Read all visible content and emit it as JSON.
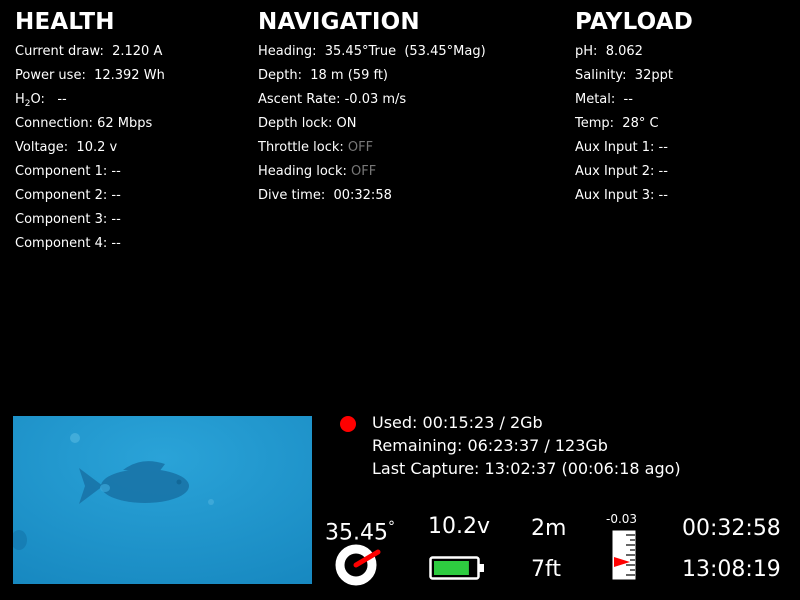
{
  "health": {
    "title": "HEALTH",
    "current_draw_label": "Current draw:",
    "current_draw_value": "2.120 A",
    "power_use_label": "Power use:",
    "power_use_value": "12.392 Wh",
    "h2o_prefix": "H",
    "h2o_sub": "2",
    "h2o_suffix": "O:",
    "h2o_value": "--",
    "connection_label": "Connection:",
    "connection_value": "62 Mbps",
    "voltage_label": "Voltage:",
    "voltage_value": "10.2 v",
    "component1_label": "Component 1:",
    "component1_value": "--",
    "component2_label": "Component 2:",
    "component2_value": "--",
    "component3_label": "Component 3:",
    "component3_value": "--",
    "component4_label": "Component 4:",
    "component4_value": "--"
  },
  "navigation": {
    "title": "NAVIGATION",
    "heading_label": "Heading:",
    "heading_value": "35.45°True  (53.45°Mag)",
    "depth_label": "Depth:",
    "depth_value": "18 m (59 ft)",
    "ascent_label": "Ascent Rate:",
    "ascent_value": "-0.03 m/s",
    "depth_lock_label": "Depth lock:",
    "depth_lock_value": "ON",
    "throttle_lock_label": "Throttle lock:",
    "throttle_lock_value": "OFF",
    "heading_lock_label": "Heading lock:",
    "heading_lock_value": "OFF",
    "dive_time_label": "Dive time:",
    "dive_time_value": "00:32:58"
  },
  "payload": {
    "title": "PAYLOAD",
    "ph_label": "pH:",
    "ph_value": "8.062",
    "salinity_label": "Salinity:",
    "salinity_value": "32ppt",
    "metal_label": "Metal:",
    "metal_value": "--",
    "temp_label": "Temp:",
    "temp_value": "28° C",
    "aux1_label": "Aux Input 1:",
    "aux1_value": "--",
    "aux2_label": "Aux Input 2:",
    "aux2_value": "--",
    "aux3_label": "Aux Input 3:",
    "aux3_value": "--"
  },
  "recording": {
    "used": "Used:  00:15:23  /  2Gb",
    "remaining": "Remaining:  06:23:37  /  123Gb",
    "last_capture": "Last Capture:  13:02:37 (00:06:18 ago)"
  },
  "hud": {
    "heading": "35.45",
    "heading_degree": "°",
    "voltage": "10.2v",
    "battery_level": 0.85,
    "depth_m": "2m",
    "depth_ft": "7ft",
    "ascent_rate": "-0.03",
    "dive_time": "00:32:58",
    "clock": "13:08:19"
  },
  "colors": {
    "background": "#000000",
    "text": "#ffffff",
    "dim_text": "#777777",
    "record": "#ff0000",
    "battery": "#2ecc40",
    "water": "#1b97cf"
  }
}
